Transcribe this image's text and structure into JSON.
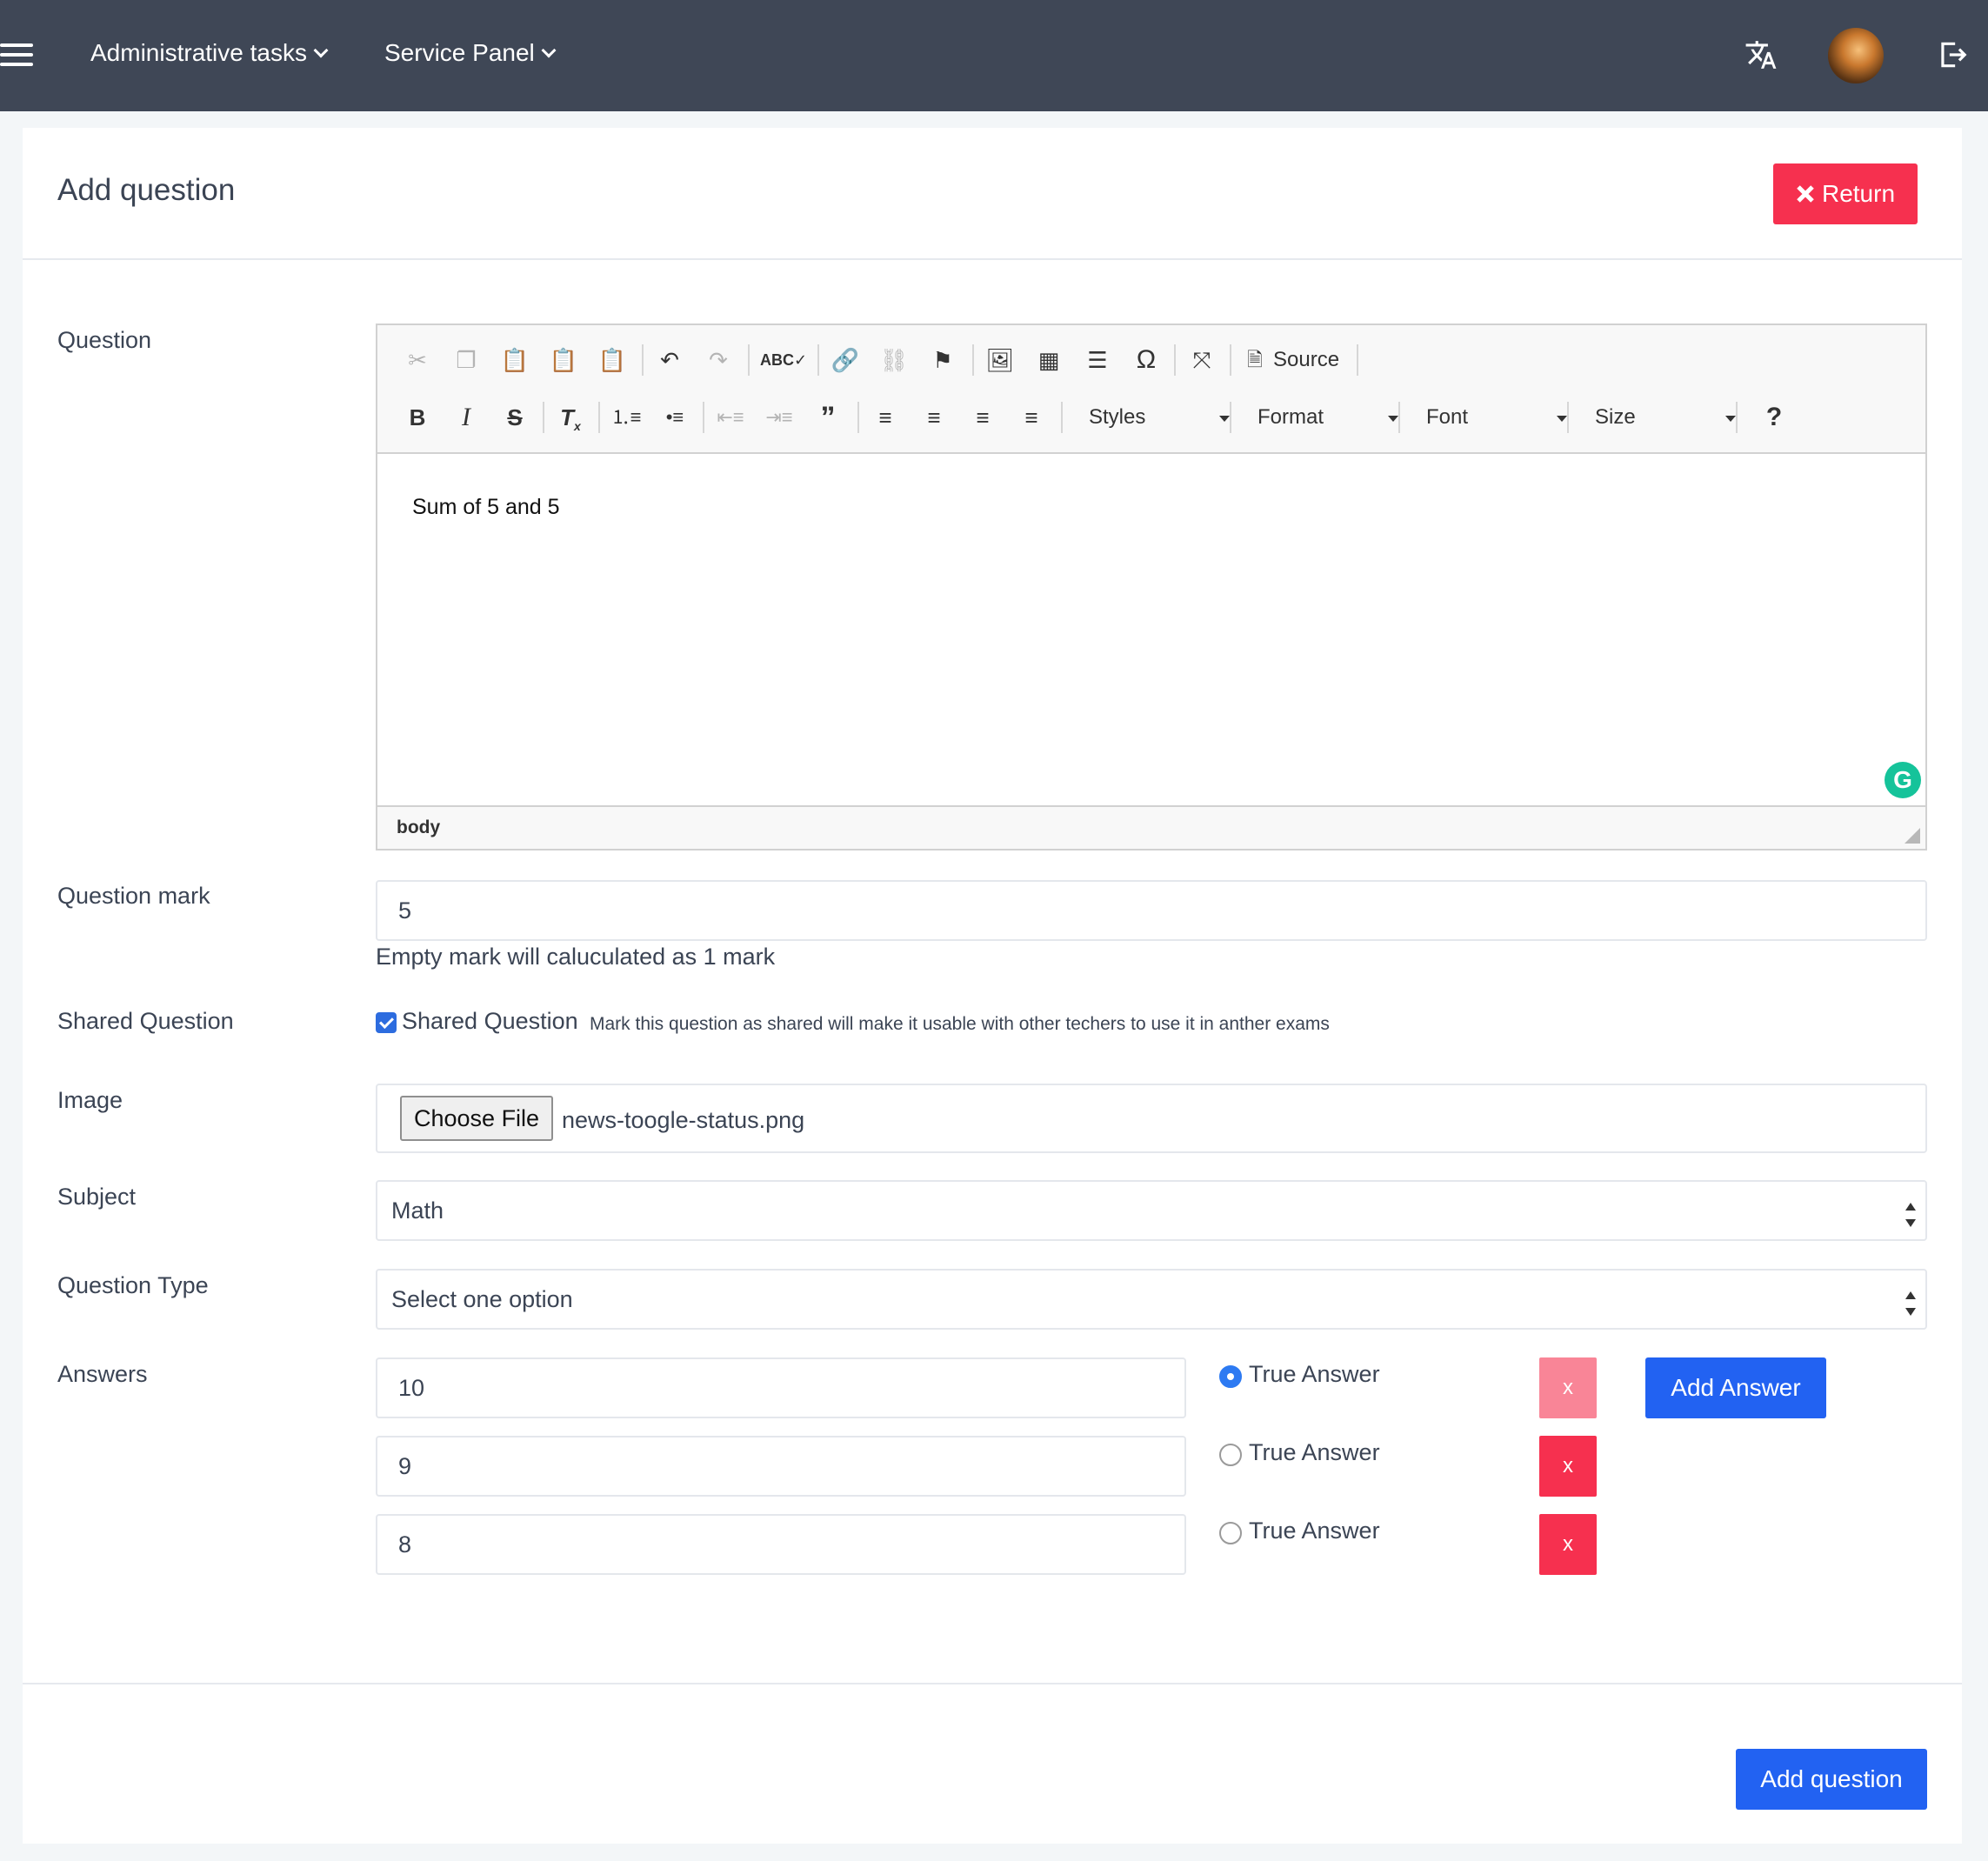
{
  "topbar": {
    "menu_icon": "hamburger-icon",
    "nav": [
      {
        "label": "Administrative tasks"
      },
      {
        "label": "Service Panel"
      }
    ],
    "translate_icon": "translate-icon",
    "logout_icon": "logout-icon",
    "bg_color": "#3f4756"
  },
  "page": {
    "title": "Add question",
    "return_label": "Return",
    "return_icon": "close-icon",
    "return_color": "#f6304f"
  },
  "form": {
    "question": {
      "label": "Question",
      "content": "Sum of 5 and 5",
      "toolbar": {
        "styles": "Styles",
        "format": "Format",
        "font": "Font",
        "size": "Size",
        "source": "Source",
        "help": "?"
      },
      "status_path": "body"
    },
    "mark": {
      "label": "Question mark",
      "value": "5",
      "help": "Empty mark will caluculated as 1 mark"
    },
    "shared": {
      "label": "Shared Question",
      "checkbox_label": "Shared Question",
      "checked": true,
      "hint": "Mark this question as shared will make it usable with other techers to use it in anther exams"
    },
    "image": {
      "label": "Image",
      "button": "Choose File",
      "filename": "news-toogle-status.png"
    },
    "subject": {
      "label": "Subject",
      "selected": "Math"
    },
    "question_type": {
      "label": "Question Type",
      "selected": "Select one option"
    },
    "answers": {
      "label": "Answers",
      "true_label": "True Answer",
      "remove_label": "x",
      "add_label": "Add Answer",
      "items": [
        {
          "value": "10",
          "true": true
        },
        {
          "value": "9",
          "true": false
        },
        {
          "value": "8",
          "true": false
        }
      ]
    },
    "submit_label": "Add question",
    "accent_color": "#2262f2"
  }
}
